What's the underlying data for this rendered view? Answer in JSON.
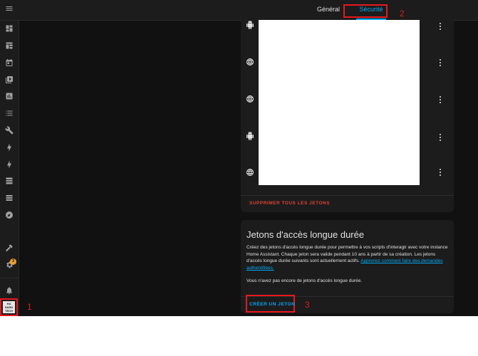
{
  "topbar": {
    "tabs": [
      {
        "label": "Général"
      },
      {
        "label": "Sécurité"
      }
    ]
  },
  "sidebar": {
    "items": [
      {
        "icon": "menu-icon"
      },
      {
        "icon": "dashboard-icon"
      },
      {
        "icon": "energy-panel-icon"
      },
      {
        "icon": "calendar-icon"
      },
      {
        "icon": "media-icon"
      },
      {
        "icon": "history-icon"
      },
      {
        "icon": "logbook-icon"
      },
      {
        "icon": "wrench-icon"
      },
      {
        "icon": "lightning-icon"
      },
      {
        "icon": "lightning-icon"
      },
      {
        "icon": "server-icon"
      },
      {
        "icon": "server-icon"
      },
      {
        "icon": "compass-icon"
      },
      {
        "icon": "hammer-icon"
      },
      {
        "icon": "gear-icon"
      },
      {
        "icon": "bell-icon"
      }
    ],
    "settings_badge": "3",
    "avatar_text": "HA HARD TECH"
  },
  "refresh_tokens": {
    "rows": [
      {
        "icon": "android-icon"
      },
      {
        "icon": "web-icon"
      },
      {
        "icon": "web-icon"
      },
      {
        "icon": "android-icon"
      },
      {
        "icon": "web-icon"
      }
    ],
    "delete_all_label": "SUPPRIMER TOUS LES JETONS"
  },
  "long_lived": {
    "title": "Jetons d'accès longue durée",
    "description": "Créez des jetons d'accès longue durée pour permettre à vos scripts d'interagir avec votre instance Home Assistant. Chaque jeton sera valide pendant 10 ans à partir de sa création. Les jetons d'accès longue durée suivants sont actuellement actifs.",
    "link_text": "Apprenez comment faire des demandes authentifiées.",
    "empty_text": "Vous n'avez pas encore de jetons d'accès longue durée.",
    "create_label": "CRÉER UN JETON"
  },
  "annotations": {
    "one": "1",
    "two": "2",
    "three": "3"
  },
  "colors": {
    "accent": "#03a9f4",
    "danger": "#db4437",
    "annotation": "#e8181e",
    "badge": "#f0a028"
  }
}
